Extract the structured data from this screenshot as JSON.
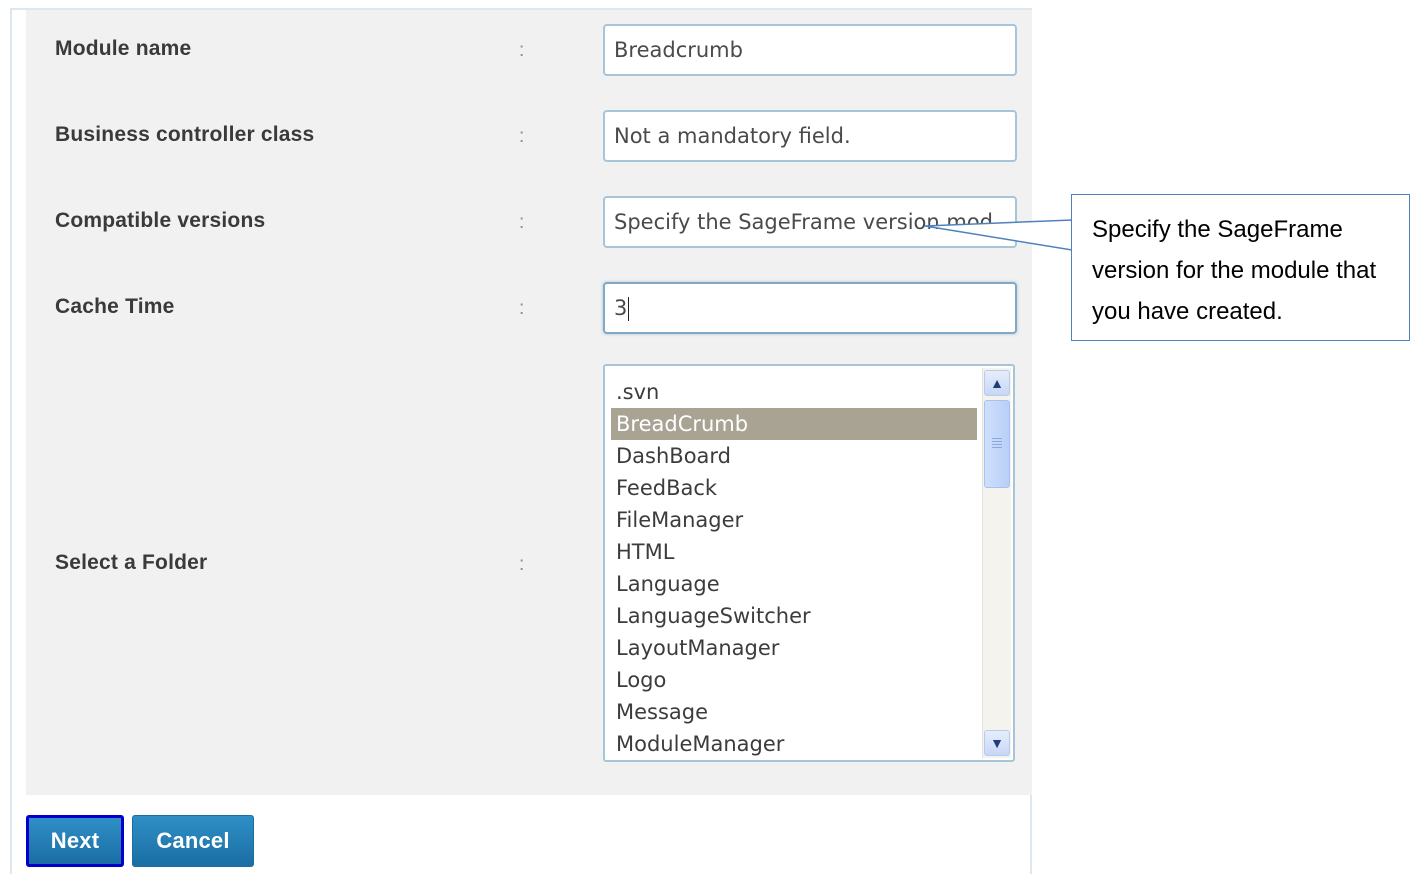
{
  "form": {
    "module_name_label": "Module name",
    "business_controller_label": "Business controller class",
    "compatible_versions_label": "Compatible versions",
    "cache_time_label": "Cache Time",
    "select_folder_label": "Select a Folder",
    "colon": ":",
    "module_name_value": "Breadcrumb",
    "business_controller_value": "Not a mandatory field.",
    "compatible_versions_value": "Specify the SageFrame version mod",
    "cache_time_value": "3"
  },
  "folder_list": {
    "items": [
      ".svn",
      "BreadCrumb",
      "DashBoard",
      "FeedBack",
      "FileManager",
      "HTML",
      "Language",
      "LanguageSwitcher",
      "LayoutManager",
      "Logo",
      "Message",
      "ModuleManager"
    ],
    "selected": "BreadCrumb"
  },
  "buttons": {
    "next": "Next",
    "cancel": "Cancel"
  },
  "callout": {
    "text": "Specify the SageFrame version for the module that you have created."
  },
  "colors": {
    "button_blue": "#2180b8",
    "selected_item": "#a9a393",
    "input_border": "#a7c5d9",
    "callout_border": "#4f81bd"
  }
}
